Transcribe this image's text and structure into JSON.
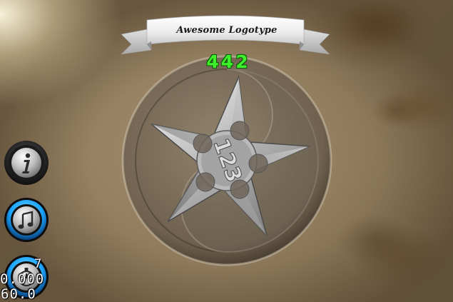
{
  "banner": {
    "title": "Awesome Logotype"
  },
  "score": {
    "value": "442"
  },
  "shuriken": {
    "emblem_text": "123"
  },
  "side_buttons": {
    "info_icon": "info-icon",
    "music_icon": "music-note-icon",
    "timer_icon": "stopwatch-icon"
  },
  "timer": {
    "top": "7",
    "middle": "0.000",
    "bottom": "60.0"
  },
  "colors": {
    "score_green": "#3ef02a",
    "button_blue": "#1aa6ff",
    "banner_white": "#f4f4f4"
  }
}
